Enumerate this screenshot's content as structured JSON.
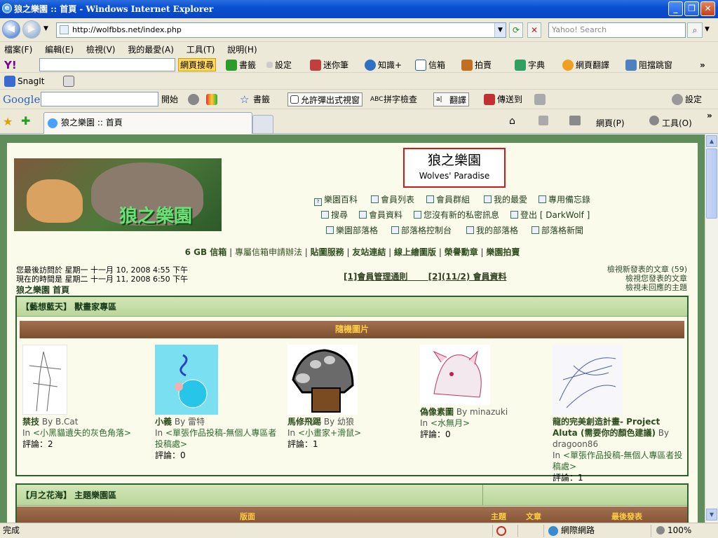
{
  "window": {
    "title": "狼之樂園 :: 首頁 - Windows Internet Explorer",
    "min_glyph": "_",
    "max_glyph": "❐",
    "close_glyph": "✕"
  },
  "address_bar": {
    "url": "http://wolfbbs.net/index.php",
    "search_placeholder": "Yahoo! Search"
  },
  "menu": [
    "檔案(F)",
    "編輯(E)",
    "檢視(V)",
    "我的最愛(A)",
    "工具(T)",
    "說明(H)"
  ],
  "yahoo_toolbar": {
    "logo": "Y!",
    "search_btn": "網頁搜尋",
    "items": [
      "書籤",
      "設定",
      "迷你筆",
      "知識+",
      "信箱",
      "拍賣",
      "字典",
      "網頁翻譯",
      "阻擋跳窗"
    ],
    "more": "»"
  },
  "snagit_toolbar": {
    "label": "SnagIt"
  },
  "google_toolbar": {
    "logo": "Google",
    "search_btn": "開始",
    "bookmarks": "書籤",
    "popup": "允許彈出式視窗",
    "spell": "拼字檢查",
    "translate": "翻譯",
    "sendto": "傳送到",
    "settings": "設定"
  },
  "tab": {
    "title": "狼之樂園 :: 首頁"
  },
  "command_bar": {
    "page": "網頁(P)",
    "tools": "工具(O)",
    "more": "»"
  },
  "site": {
    "title_cn": "狼之樂園",
    "title_en": "Wolves' Paradise",
    "logo_text": "狼之樂園",
    "nav_row1": [
      "樂園百科",
      "會員列表",
      "會員群組",
      "我的最愛",
      "專用備忘錄"
    ],
    "nav_row2": [
      "搜尋",
      "會員資料",
      "您沒有新的私密訊息",
      "登出 [ DarkWolf ]"
    ],
    "nav_row3": [
      "樂園部落格",
      "部落格控制台",
      "我的部落格",
      "部落格新聞"
    ],
    "bold_links": [
      "6 GB 信箱",
      "專屬信箱申請辦法",
      "貼圖服務",
      "友站連結",
      "線上繪圖版",
      "榮譽勳章",
      "樂園拍賣"
    ],
    "last_visit": "您最後訪問於 星期一 十一月 10, 2008 4:55 下午",
    "current_time": "現在的時間是 星期二 十一月 11, 2008 6:50 下午",
    "forum_index": "狼之樂園 首頁",
    "announce1": "[1]會員管理通則",
    "announce2": "[2](11/2) 會員資料",
    "right_link1": "檢視新發表的文章 (59)",
    "right_link2": "檢視您發表的文章",
    "right_link3": "檢視未回應的主題"
  },
  "section1": {
    "title": "【藝想藍天】 獸畫家專區",
    "sub": "隨機圖片",
    "cards": [
      {
        "title": "禁技",
        "by": "By B.Cat",
        "in_prefix": "In ",
        "in": "<小黑貓遺失的灰色角落>",
        "comments": "評論：2"
      },
      {
        "title": "小義",
        "by": "By 雷特",
        "in_prefix": "In ",
        "in": "<單張作品投稿-無個人專區者投稿處>",
        "comments": "評論：0"
      },
      {
        "title": "馬修飛踢",
        "by": "By 幼狼",
        "in_prefix": "In ",
        "in": "<小畫家+滑鼠>",
        "comments": "評論：1"
      },
      {
        "title": "偽像素圖",
        "by": "By minazuki",
        "in_prefix": "In ",
        "in": "<水無月>",
        "comments": "評論：0"
      },
      {
        "title": "龍的完美創造計畫- Project Aluta (需要你的顏色建議)",
        "by": "By dragoon86",
        "in_prefix": "In ",
        "in": "<單張作品投稿-無個人專區者投稿處>",
        "comments": "評論：1"
      }
    ]
  },
  "section2": {
    "title": "【月之花海】 主題樂園區",
    "col_forum": "版面",
    "col_topics": "主題",
    "col_posts": "文章",
    "col_last": "最後發表"
  },
  "status": {
    "left": "完成",
    "zone": "網際網路",
    "zoom": "100%"
  },
  "colors": {
    "page_bg": "#fbfbeb",
    "header_green": "#c4dca8",
    "brown": "#8a5a3a",
    "title_border": "#d01818"
  }
}
